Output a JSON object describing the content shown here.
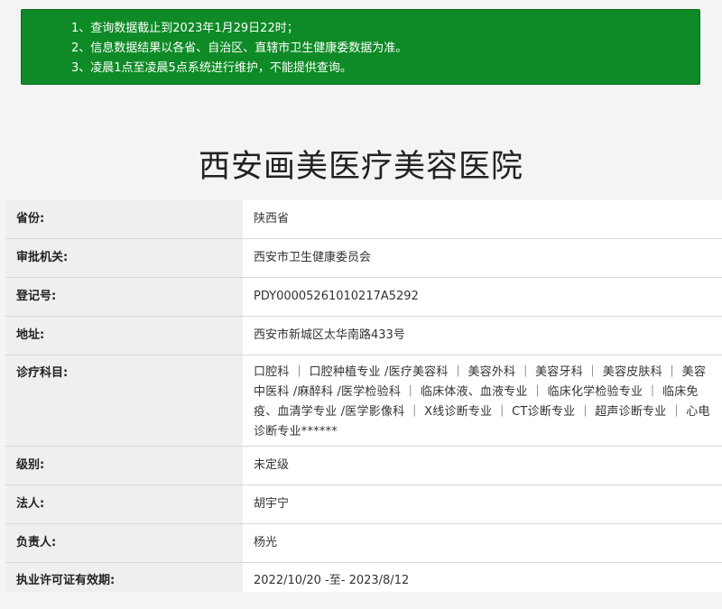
{
  "notice": {
    "line1": "1、查询数据截止到2023年1月29日22时；",
    "line2": "2、信息数据结果以各省、自治区、直辖市卫生健康委数据为准。",
    "line3": "3、凌晨1点至凌晨5点系统进行维护，不能提供查询。"
  },
  "page_title": "西安画美医疗美容医院",
  "rows": [
    {
      "label": "省份:",
      "value": "陕西省"
    },
    {
      "label": "审批机关:",
      "value": "西安市卫生健康委员会"
    },
    {
      "label": "登记号:",
      "value": "PDY00005261010217A5292"
    },
    {
      "label": "地址:",
      "value": "西安市新城区太华南路433号"
    },
    {
      "label": "诊疗科目:",
      "value": "口腔科 ｜ 口腔种植专业 /医疗美容科 ｜ 美容外科 ｜ 美容牙科 ｜ 美容皮肤科 ｜ 美容中医科 /麻醉科 /医学检验科 ｜ 临床体液、血液专业 ｜ 临床化学检验专业 ｜ 临床免疫、血清学专业 /医学影像科 ｜ X线诊断专业 ｜ CT诊断专业 ｜ 超声诊断专业 ｜ 心电诊断专业******"
    },
    {
      "label": "级别:",
      "value": "未定级"
    },
    {
      "label": "法人:",
      "value": "胡宇宁"
    },
    {
      "label": "负责人:",
      "value": "杨光"
    },
    {
      "label": "执业许可证有效期:",
      "value": "2022/10/20 -至- 2023/8/12"
    }
  ],
  "colors": {
    "notice_bg": "#0e8a26",
    "label_bg": "#efefef",
    "value_bg": "#ffffff"
  }
}
